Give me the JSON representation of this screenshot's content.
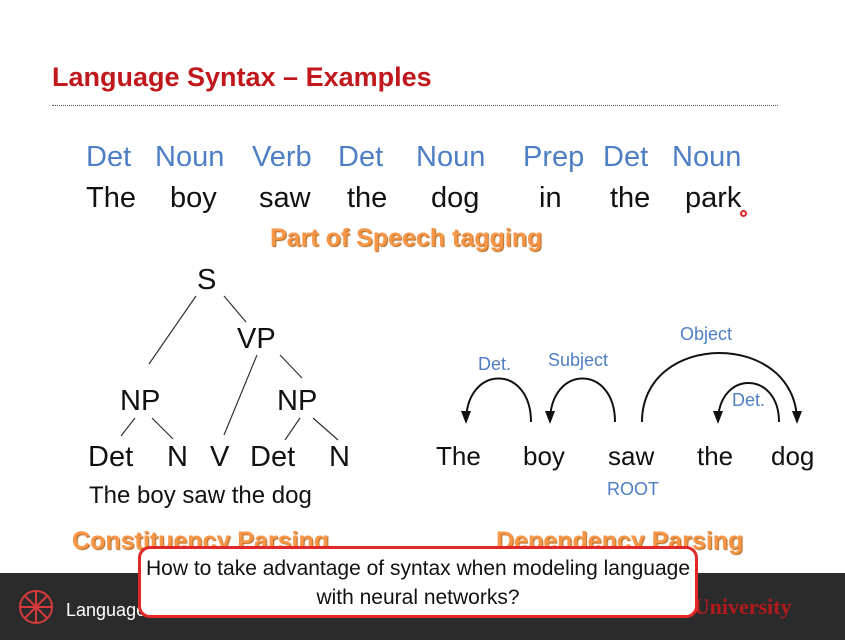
{
  "slide": {
    "title": "Language Syntax – Examples",
    "pos_tags": [
      "Det",
      "Noun",
      "Verb",
      "Det",
      "Noun",
      "Prep",
      "Det",
      "Noun"
    ],
    "sentence_words": [
      "The",
      "boy",
      "saw",
      "the",
      "dog",
      "in",
      "the",
      "park"
    ],
    "pos_caption": "Part of Speech tagging",
    "constituency": {
      "nodes": {
        "s": "S",
        "vp": "VP",
        "np1": "NP",
        "np2": "NP",
        "det1": "Det",
        "n1": "N",
        "v": "V",
        "det2": "Det",
        "n2": "N"
      },
      "sentence": "The boy saw the dog",
      "caption": "Constituency Parsing"
    },
    "dependency": {
      "words": [
        "The",
        "boy",
        "saw",
        "the",
        "dog"
      ],
      "labels": {
        "det1": "Det.",
        "subject": "Subject",
        "object": "Object",
        "det2": "Det."
      },
      "root": "ROOT",
      "caption": "Dependency Parsing"
    },
    "question": "How to take advantage of syntax when modeling language with neural networks?"
  },
  "footer": {
    "left_text": "Language",
    "right_text": "n University"
  },
  "colors": {
    "title": "#c0181c",
    "tag_blue": "#4e7ec4",
    "orange": "#f79646",
    "callout_border": "#e12727"
  }
}
